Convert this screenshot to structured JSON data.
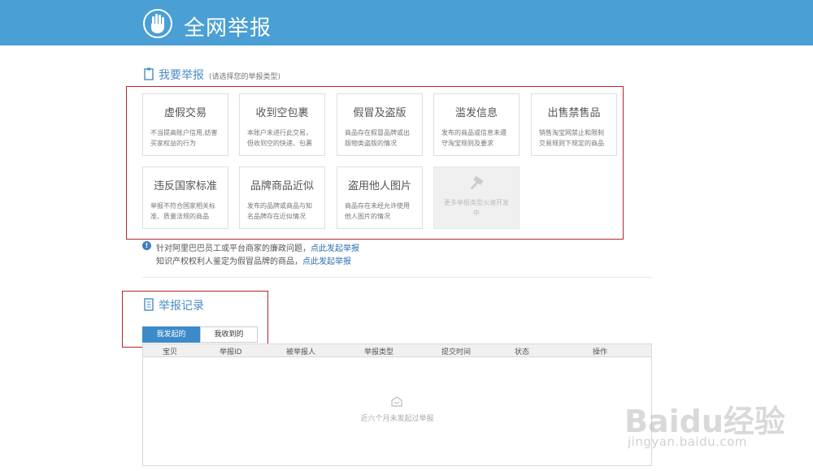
{
  "header": {
    "title": "全网举报"
  },
  "report_section": {
    "title": "我要举报",
    "hint": "(请选择您的举报类型)"
  },
  "categories": [
    {
      "title": "虚假交易",
      "desc": "不当提高账户信用,妨害买家权益的行为"
    },
    {
      "title": "收到空包裹",
      "desc": "本账户未进行此交易，但收到空的快递、包裹"
    },
    {
      "title": "假冒及盗版",
      "desc": "商品存在假冒品牌或出版物类盗版的情况"
    },
    {
      "title": "滥发信息",
      "desc": "发布的商品或信息未遵守淘宝规则及要求"
    },
    {
      "title": "出售禁售品",
      "desc": "销售淘宝网禁止和限制交易规则下规定的商品"
    },
    {
      "title": "违反国家标准",
      "desc": "举报不符合国家相关标准、质量法规的商品"
    },
    {
      "title": "品牌商品近似",
      "desc": "发布的品牌或商品与知名品牌存在近似情况"
    },
    {
      "title": "盗用他人图片",
      "desc": "商品存在未经允许使用他人图片的情况"
    }
  ],
  "more_card": {
    "desc": "更多举报类型火速开发中"
  },
  "notices": [
    {
      "text": "针对阿里巴巴员工或平台商家的廉政问题，",
      "link": "点此发起举报"
    },
    {
      "text": "知识产权权利人鉴定为假冒品牌的商品，",
      "link": "点此发起举报"
    }
  ],
  "records_section": {
    "title": "举报记录"
  },
  "tabs": [
    {
      "label": "我发起的",
      "active": true
    },
    {
      "label": "我收到的",
      "active": false
    }
  ],
  "table": {
    "columns": [
      "宝贝",
      "举报ID",
      "被举报人",
      "举报类型",
      "提交时间",
      "状态",
      "操作"
    ],
    "empty_text": "近六个月未发起过举报"
  },
  "watermark": {
    "main": "Baidu经验",
    "sub": "jingyan.baidu.com"
  },
  "colors": {
    "header": "#4a9fd5",
    "accent": "#4a8cc4",
    "highlight_box": "#b8252a",
    "link": "#2d6fb0"
  }
}
